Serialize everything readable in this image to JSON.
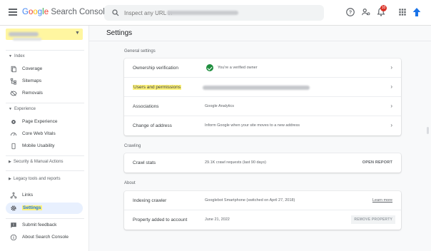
{
  "app": {
    "logo_google": [
      "G",
      "o",
      "o",
      "g",
      "l",
      "e"
    ],
    "logo_product": "Search Console"
  },
  "search": {
    "placeholder": "Inspect any URL in"
  },
  "topbar": {
    "notifications_count": "10"
  },
  "sidebar": {
    "sections": {
      "index": "Index",
      "experience": "Experience",
      "security": "Security & Manual Actions",
      "legacy": "Legacy tools and reports"
    },
    "items": {
      "coverage": "Coverage",
      "sitemaps": "Sitemaps",
      "removals": "Removals",
      "page_experience": "Page Experience",
      "core_web_vitals": "Core Web Vitals",
      "mobile_usability": "Mobile Usability",
      "links": "Links",
      "settings": "Settings",
      "submit_feedback": "Submit feedback",
      "about": "About Search Console"
    }
  },
  "main": {
    "title": "Settings",
    "general": {
      "label": "General settings",
      "rows": {
        "ownership": {
          "name": "Ownership verification",
          "value": "You're a verified owner"
        },
        "users": {
          "name": "Users and permissions"
        },
        "associations": {
          "name": "Associations",
          "value": "Google Analytics"
        },
        "change_address": {
          "name": "Change of address",
          "value": "Inform Google when your site moves to a new address"
        }
      }
    },
    "crawling": {
      "label": "Crawling",
      "crawl_stats": {
        "name": "Crawl stats",
        "value": "29.1K crawl requests (last 90 days)",
        "action": "OPEN REPORT"
      }
    },
    "about": {
      "label": "About",
      "indexing_crawler": {
        "name": "Indexing crawler",
        "value": "Googlebot Smartphone (switched on April 27, 2018)",
        "action": "Learn more"
      },
      "property_added": {
        "name": "Property added to account",
        "value": "June 21, 2022",
        "action": "REMOVE PROPERTY"
      }
    }
  },
  "colors": {
    "accent": "#1a73e8",
    "highlight": "#fff37a",
    "success": "#1e8e3e",
    "badge": "#d93025"
  }
}
